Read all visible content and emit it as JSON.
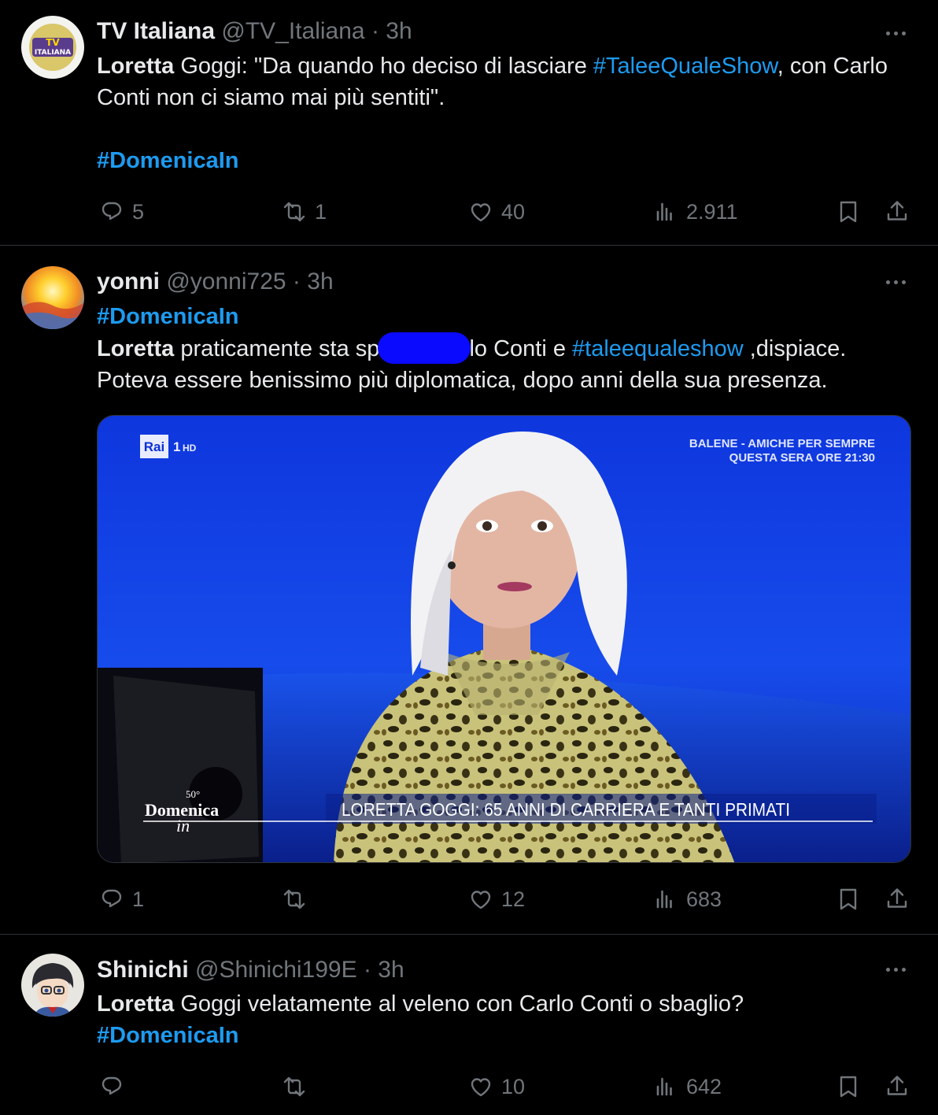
{
  "tweets": [
    {
      "name": "TV Italiana",
      "handle": "@TV_Italiana",
      "sep": "·",
      "time": "3h",
      "avatar_text": "TV ITALIANA",
      "text_parts": {
        "p1": "Loretta",
        "p2": " Goggi: \"Da quando ho deciso di lasciare ",
        "p3": "#TaleeQualeShow",
        "p4": ", con Carlo Conti non ci siamo mai più sentiti\".",
        "p5": "#DomenicaIn"
      },
      "stats": {
        "replies": "5",
        "retweets": "1",
        "likes": "40",
        "views": "2.911"
      }
    },
    {
      "name": "yonni",
      "handle": "@yonni725",
      "sep": "·",
      "time": "3h",
      "text_parts": {
        "p1": "#DomenicaIn",
        "p2": "Loretta",
        "p3": " praticamente sta sp",
        "p4": "lo Conti e ",
        "p5": "#taleequaleshow",
        "p6": " ,dispiace.",
        "p7": "Poteva essere benissimo più diplomatica, dopo anni della sua presenza."
      },
      "media": {
        "channel_logo": "Rai",
        "channel_num": "1",
        "channel_hd": "HD",
        "promo_line1": "BALENE - AMICHE PER SEMPRE",
        "promo_line2": "QUESTA SERA ORE 21:30",
        "show_badge": "50°",
        "show_name": "Domenica",
        "show_sub": "in",
        "caption": "LORETTA GOGGI: 65 ANNI DI CARRIERA E TANTI PRIMATI"
      },
      "stats": {
        "replies": "1",
        "retweets": "",
        "likes": "12",
        "views": "683"
      }
    },
    {
      "name": "Shinichi",
      "handle": "@Shinichi199E",
      "sep": "·",
      "time": "3h",
      "text_parts": {
        "p1": "Loretta",
        "p2": " Goggi velatamente al veleno con Carlo Conti o sbaglio?",
        "p3": "#DomenicaIn"
      },
      "stats": {
        "replies": "",
        "retweets": "",
        "likes": "10",
        "views": "642"
      }
    }
  ],
  "colors": {
    "background": "#000000",
    "link": "#1d9bf0",
    "muted": "#71767b",
    "text": "#e7e9ea"
  },
  "icons": [
    "reply-icon",
    "retweet-icon",
    "like-icon",
    "views-icon",
    "bookmark-icon",
    "share-icon",
    "more-icon"
  ]
}
